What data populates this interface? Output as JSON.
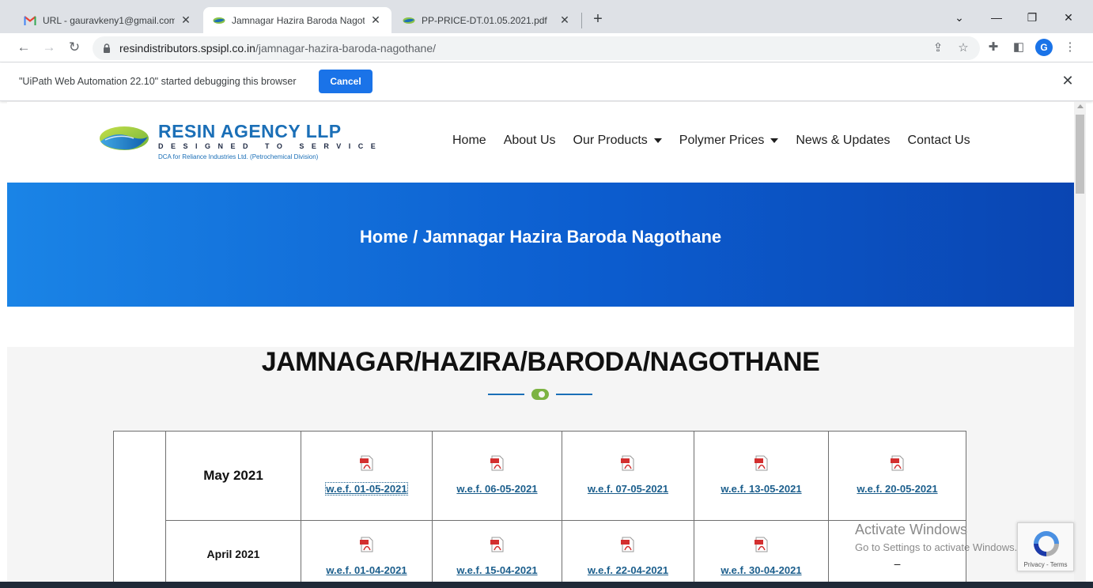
{
  "browser": {
    "tabs": [
      {
        "title": "URL - gauravkeny1@gmail.com -",
        "icon": "gmail-icon",
        "active": false
      },
      {
        "title": "Jamnagar Hazira Baroda Nagoth",
        "icon": "resin-agency-favicon",
        "active": true
      },
      {
        "title": "PP-PRICE-DT.01.05.2021.pdf",
        "icon": "resin-agency-favicon",
        "active": false
      }
    ],
    "url_host": "resindistributors.spsipl.co.in",
    "url_path": "/jamnagar-hazira-baroda-nagothane/",
    "profile_initial": "G",
    "infobar_message": "\"UiPath Web Automation 22.10\" started debugging this browser",
    "infobar_cancel": "Cancel"
  },
  "site": {
    "logo_name": "RESIN AGENCY LLP",
    "logo_tagline": "DESIGNED TO SERVICE",
    "logo_sub": "DCA for Reliance Industries Ltd. (Petrochemical Division)",
    "nav": [
      {
        "label": "Home",
        "dropdown": false
      },
      {
        "label": "About Us",
        "dropdown": false
      },
      {
        "label": "Our Products",
        "dropdown": true
      },
      {
        "label": "Polymer Prices",
        "dropdown": true
      },
      {
        "label": "News & Updates",
        "dropdown": false
      },
      {
        "label": "Contact Us",
        "dropdown": false
      }
    ],
    "breadcrumb": "Home / Jamnagar Hazira Baroda Nagothane",
    "heading": "JAMNAGAR/HAZIRA/BARODA/NAGOTHANE",
    "table": {
      "rows": [
        {
          "month": "May 2021",
          "links": [
            "w.e.f. 01-05-2021",
            "w.e.f. 06-05-2021",
            "w.e.f. 07-05-2021",
            "w.e.f. 13-05-2021",
            "w.e.f. 20-05-2021"
          ]
        },
        {
          "month": "April 2021",
          "links": [
            "w.e.f. 01-04-2021",
            "w.e.f. 15-04-2021",
            "w.e.f. 22-04-2021",
            "w.e.f. 30-04-2021"
          ],
          "last_cell": "–"
        }
      ]
    }
  },
  "overlays": {
    "activate_title": "Activate Windows",
    "activate_sub": "Go to Settings to activate Windows.",
    "recaptcha_links": "Privacy - Terms"
  },
  "colors": {
    "brand_blue": "#1b6fb7",
    "hero_start": "#1a84e6",
    "hero_end": "#0a45b2",
    "accent_green": "#7cb342",
    "chrome_blue": "#1a73e8"
  }
}
